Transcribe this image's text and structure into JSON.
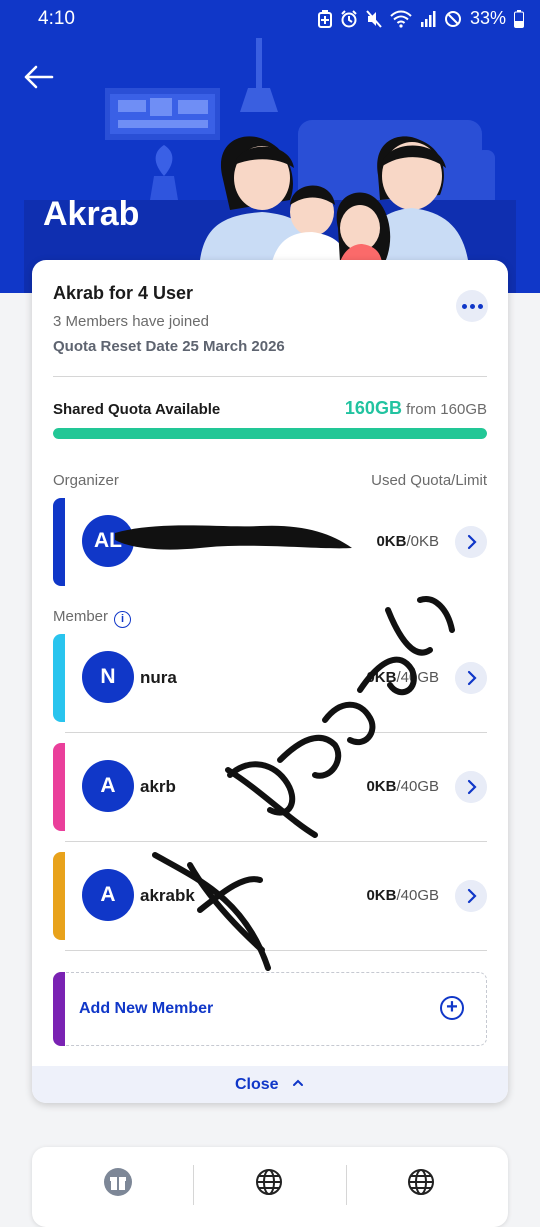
{
  "status_bar": {
    "time": "4:10",
    "battery": "33%"
  },
  "header": {
    "title": "Akrab"
  },
  "package": {
    "title": "Akrab for 4 User",
    "members_joined": "3 Members have joined",
    "reset_date": "Quota Reset Date 25 March 2026"
  },
  "quota": {
    "label": "Shared Quota Available",
    "available": "160GB",
    "from_text": "from 160GB",
    "fill_fraction": 1.0
  },
  "organizer_section": {
    "label": "Organizer",
    "right_label": "Used Quota/Limit"
  },
  "organizer": {
    "initials": "AL",
    "used": "0KB",
    "limit": "/0KB",
    "stripe_color": "#1037c8"
  },
  "member_section": {
    "label": "Member"
  },
  "members": [
    {
      "initial": "N",
      "name": "nura",
      "used": "0KB",
      "limit": "/40GB",
      "stripe_color": "#29c4ee"
    },
    {
      "initial": "A",
      "name": "akrb",
      "used": "0KB",
      "limit": "/40GB",
      "stripe_color": "#ea3f9b"
    },
    {
      "initial": "A",
      "name": "akrabk",
      "used": "0KB",
      "limit": "/40GB",
      "stripe_color": "#e8a21b"
    }
  ],
  "add_member": {
    "label": "Add New Member"
  },
  "close": {
    "label": "Close"
  },
  "colors": {
    "brand": "#1037c8",
    "quota_green": "#22c3a0"
  },
  "icons": [
    "back-arrow-icon",
    "more-icon",
    "info-icon",
    "chevron-right-icon",
    "plus-circle-icon",
    "chevron-up-icon",
    "gift-icon",
    "globe-icon"
  ]
}
